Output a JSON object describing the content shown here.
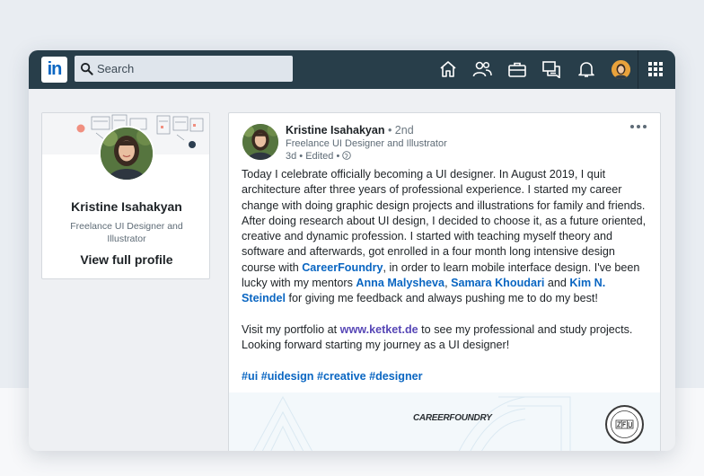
{
  "nav": {
    "logo_text": "in",
    "search_placeholder": "Search",
    "icons": [
      "home-icon",
      "my-network-icon",
      "jobs-icon",
      "messaging-icon",
      "notifications-icon",
      "profile-avatar",
      "apps-grid-icon"
    ]
  },
  "profile": {
    "name": "Kristine Isahakyan",
    "title": "Freelance UI Designer and Illustrator",
    "link": "View full profile"
  },
  "post": {
    "author": "Kristine Isahakyan",
    "degree": "• 2nd",
    "author_title": "Freelance UI Designer and Illustrator",
    "meta": "3d • Edited •",
    "p1_a": "Today I celebrate officially becoming a UI designer. In August 2019, I quit architecture after three years of professional experience. I started my career change with doing graphic design projects and illustrations for family and friends. After doing research about UI design, I decided to choose it, as a future oriented, creative and dynamic profession. I started with teaching myself theory and software and afterwards, got enrolled in a four month long intensive design course with ",
    "link_cf": "CareerFoundry",
    "p1_b": ", in order to learn mobile interface design. I've been lucky with my mentors ",
    "mentor1": "Anna Malysheva",
    "sep1": ", ",
    "mentor2": "Samara Khoudari",
    "sep2": " and ",
    "mentor3": "Kim N. Steindel",
    "p1_c": " for giving me feedback and always pushing me to do my best!",
    "p2_a": "Visit my portfolio at ",
    "portfolio": "www.ketket.de",
    "p2_b": " to see my professional and study projects. Looking forward starting my journey as a UI designer!",
    "hashtags": "#ui #uidesign #creative #designer",
    "media_logo": "CAREERFOUNDRY"
  },
  "colors": {
    "nav_bg": "#283e4a",
    "link": "#0a66c2",
    "portfolio_link": "#5747b6"
  }
}
